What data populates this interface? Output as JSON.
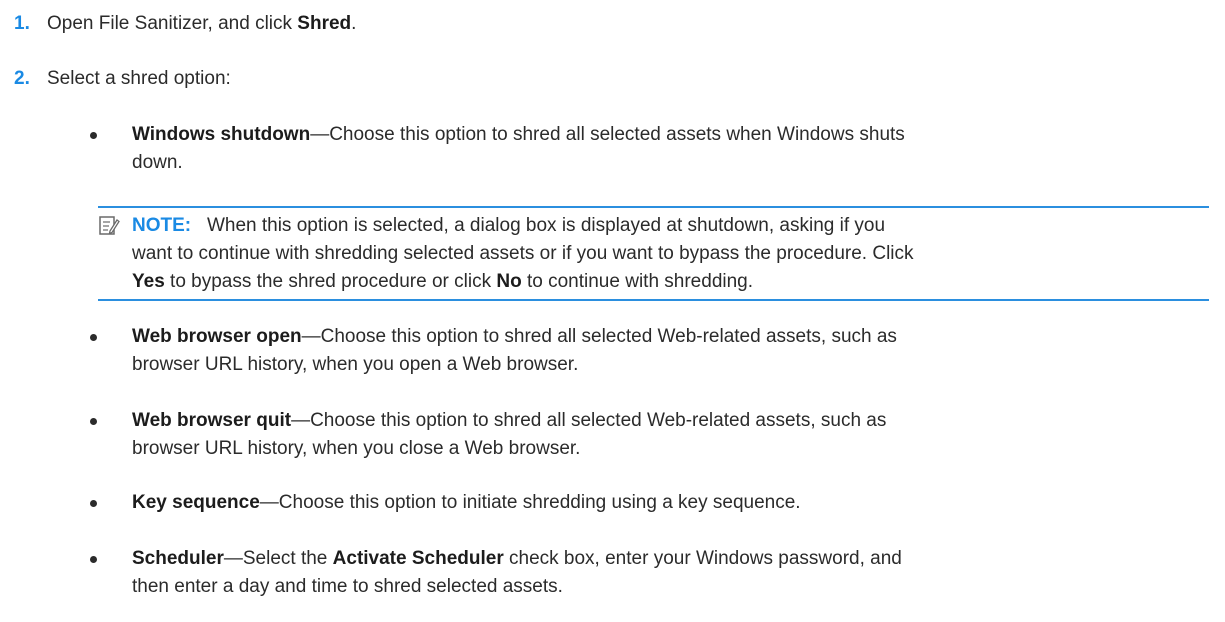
{
  "steps": [
    {
      "number": "1.",
      "pre": "Open File Sanitizer, and click ",
      "bold": "Shred",
      "post": "."
    },
    {
      "number": "2.",
      "text": "Select a shred option:"
    }
  ],
  "options": {
    "windows_shutdown": {
      "term": "Windows shutdown",
      "line1": "—Choose this option to shred all selected assets when Windows shuts",
      "line2": "down."
    },
    "web_open": {
      "term": "Web browser open",
      "line1": "—Choose this option to shred all selected Web-related assets, such as",
      "line2": "browser URL history, when you open a Web browser."
    },
    "web_quit": {
      "term": "Web browser quit",
      "line1": "—Choose this option to shred all selected Web-related assets, such as",
      "line2": "browser URL history, when you close a Web browser."
    },
    "key_sequence": {
      "term": "Key sequence",
      "line1": "—Choose this option to initiate shredding using a key sequence."
    },
    "scheduler": {
      "term": "Scheduler",
      "line1_a": "—Select the ",
      "line1_bold": "Activate Scheduler",
      "line1_b": " check box, enter your Windows password, and",
      "line2": "then enter a day and time to shred selected assets."
    }
  },
  "note": {
    "label": "NOTE:",
    "line1": "When this option is selected, a dialog box is displayed at shutdown, asking if you",
    "line2": "want to continue with shredding selected assets or if you want to bypass the procedure. Click",
    "line3_yes": "Yes",
    "line3_a": " to bypass the shred procedure or click ",
    "line3_no": "No",
    "line3_b": " to continue with shredding.",
    "icon": "note-pencil-icon",
    "accent": "#2b8fdf"
  },
  "colors": {
    "step_number": "#1a8ae4",
    "text": "#2b2b2b"
  }
}
